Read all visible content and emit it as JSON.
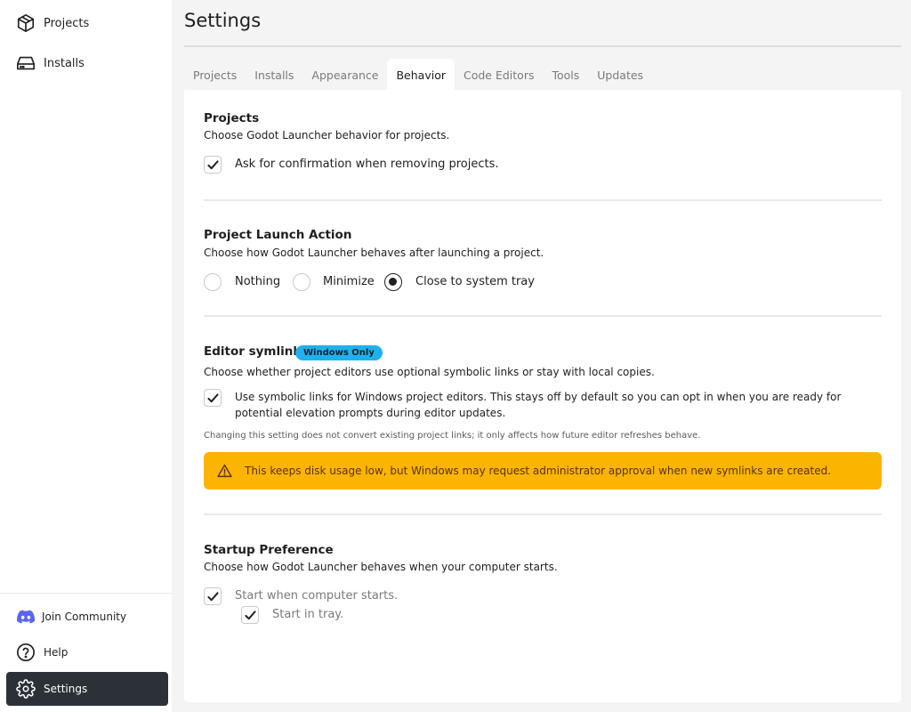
{
  "sidebar": {
    "top_items": [
      {
        "label": "Projects",
        "icon": "package-icon"
      },
      {
        "label": "Installs",
        "icon": "hard-drive-icon"
      }
    ],
    "bottom_items": [
      {
        "label": "Join Community",
        "icon": "discord-icon"
      },
      {
        "label": "Help",
        "icon": "help-circle-icon"
      },
      {
        "label": "Settings",
        "icon": "gear-icon",
        "active": true
      }
    ]
  },
  "page": {
    "title": "Settings"
  },
  "tabs": [
    {
      "label": "Projects"
    },
    {
      "label": "Installs"
    },
    {
      "label": "Appearance"
    },
    {
      "label": "Behavior",
      "active": true
    },
    {
      "label": "Code Editors"
    },
    {
      "label": "Tools"
    },
    {
      "label": "Updates"
    }
  ],
  "sections": {
    "projects": {
      "title": "Projects",
      "description": "Choose Godot Launcher behavior for projects.",
      "confirm_remove": {
        "label": "Ask for confirmation when removing projects.",
        "checked": true
      }
    },
    "launch_action": {
      "title": "Project Launch Action",
      "description": "Choose how Godot Launcher behaves after launching a project.",
      "options": [
        {
          "label": "Nothing",
          "selected": false
        },
        {
          "label": "Minimize",
          "selected": false
        },
        {
          "label": "Close to system tray",
          "selected": true
        }
      ]
    },
    "symlinks": {
      "title": "Editor symlinks",
      "badge": "Windows Only",
      "description": "Choose whether project editors use optional symbolic links or stay with local copies.",
      "use_symlinks": {
        "label": "Use symbolic links for Windows project editors. This stays off by default so you can opt in when you are ready for potential elevation prompts during editor updates.",
        "checked": true
      },
      "note": "Changing this setting does not convert existing project links; it only affects how future editor refreshes behave.",
      "warning": "This keeps disk usage low, but Windows may request administrator approval when new symlinks are created."
    },
    "startup": {
      "title": "Startup Preference",
      "description": "Choose how Godot Launcher behaves when your computer starts.",
      "start_with_computer": {
        "label": "Start when computer starts.",
        "checked": true
      },
      "start_in_tray": {
        "label": "Start in tray.",
        "checked": true
      }
    }
  },
  "colors": {
    "accent_dark": "#2c3138",
    "badge": "#1eb1ee",
    "warning": "#fbb400",
    "discord": "#5865f2"
  }
}
